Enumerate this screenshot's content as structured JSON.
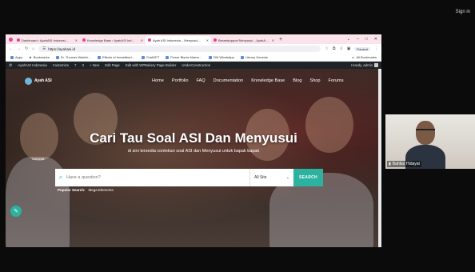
{
  "top": {
    "sign_in": "Sign in"
  },
  "tabs": [
    {
      "label": "Dashboard ‹ AyahASI Indonesi…"
    },
    {
      "label": "Knowledge Base ‹ AyahASI Ind…"
    },
    {
      "label": "Ayah ASI Indonesia – Menyusui…"
    },
    {
      "label": "Breastsupport Menyusui – AyahA…"
    }
  ],
  "window_controls": [
    "⌄",
    "–",
    "□",
    "✕"
  ],
  "address": {
    "url": "https://ayahasi.id",
    "profile": "Paused"
  },
  "bookmarks": [
    {
      "label": "Apps"
    },
    {
      "label": "Bookmarks"
    },
    {
      "label": "Dr. Thomas Wadeh…"
    },
    {
      "label": "Effects of breastfeed…"
    },
    {
      "label": "ChatGPT"
    },
    {
      "label": "Power Bisnis Mama…"
    },
    {
      "label": "206 WhatsApp"
    },
    {
      "label": "Library Genesis"
    },
    {
      "label": "All Bookmarks"
    }
  ],
  "wp_admin_bar": {
    "items": [
      "AyahASI Indonesia",
      "Customize",
      "7",
      "3",
      "+ New",
      "Edit Page",
      "Edit with WPBakery Page Builder",
      "UnderConstruction"
    ],
    "greeting": "Howdy, admin"
  },
  "site": {
    "logo_text": "Ayah ASI",
    "logo_sub": "Indonesia",
    "menu": [
      "Home",
      "Portfolio",
      "FAQ",
      "Documentation",
      "Knowledge Base",
      "Blog",
      "Shop",
      "Forums"
    ],
    "headline": "Cari Tau Soal ASI Dan Menyusui",
    "subheadline": "di sini tersedia contekan soal ASI dan Menyusui untuk bapak bapak",
    "search_placeholder": "Have a question?",
    "search_scope": "All Site",
    "search_button": "SEARCH",
    "popular_label": "Popular Search:",
    "popular_items": [
      "Mega Elements"
    ]
  },
  "video": {
    "participant": "Bahtiar Hidayat"
  }
}
